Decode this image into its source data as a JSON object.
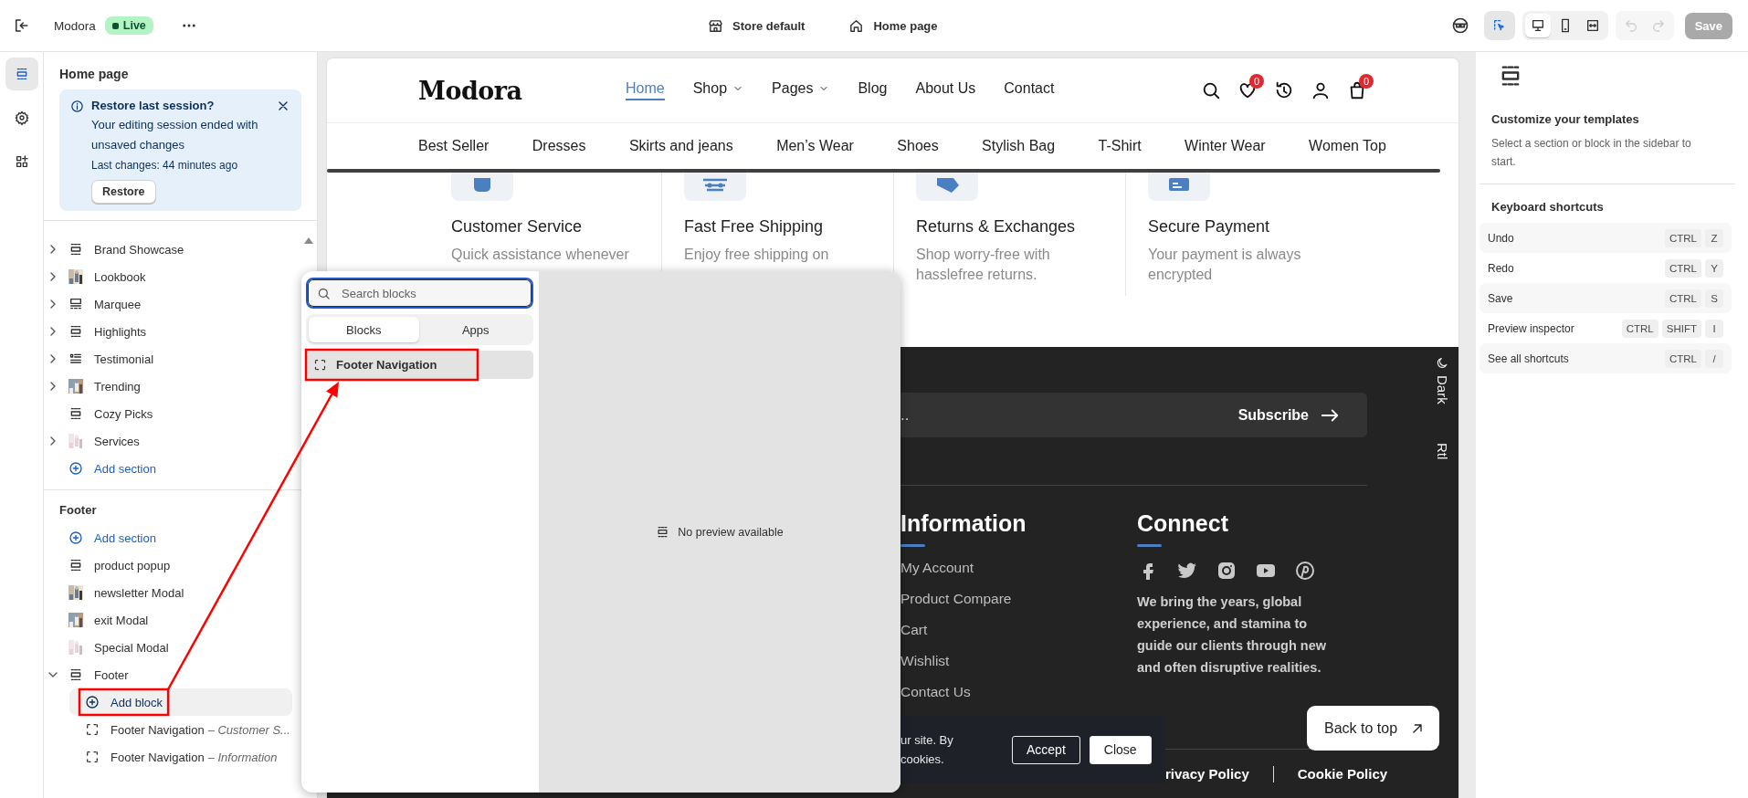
{
  "topbar": {
    "store_name": "Modora",
    "status": {
      "kind": "live",
      "label": "Live"
    },
    "context": [
      {
        "kind": "store",
        "label": "Store default"
      },
      {
        "kind": "page",
        "label": "Home page"
      }
    ],
    "tools": [
      {
        "kind": "select",
        "selected": true
      }
    ],
    "devices": [
      {
        "kind": "desktop",
        "selected": true
      },
      {
        "kind": "mobile",
        "selected": false
      },
      {
        "kind": "fullwidth",
        "selected": false
      }
    ],
    "history": [
      {
        "kind": "undo",
        "disabled": true
      },
      {
        "kind": "redo",
        "disabled": true
      }
    ],
    "save": {
      "label": "Save",
      "disabled": true
    }
  },
  "rail": [
    {
      "kind": "sections",
      "selected": true
    },
    {
      "kind": "settings",
      "selected": false
    },
    {
      "kind": "apps",
      "selected": false
    }
  ],
  "sidebar": {
    "title": "Home page",
    "notice": {
      "title": "Restore last session?",
      "message": "Your editing session ended with unsaved changes",
      "detail": "Last changes: 44 minutes ago",
      "button": "Restore"
    },
    "groups": [
      {
        "items": [
          {
            "kind": "section",
            "label": "Brand Showcase",
            "expandable": true,
            "expanded": false
          },
          {
            "kind": "thumb",
            "label": "Lookbook",
            "expandable": true,
            "expanded": false
          },
          {
            "kind": "marquee",
            "label": "Marquee",
            "expandable": true,
            "expanded": false
          },
          {
            "kind": "section",
            "label": "Highlights",
            "expandable": true,
            "expanded": false
          },
          {
            "kind": "testimonial",
            "label": "Testimonial",
            "expandable": true,
            "expanded": false
          },
          {
            "kind": "thumb",
            "label": "Trending",
            "expandable": true,
            "expanded": false
          },
          {
            "kind": "section",
            "label": "Cozy Picks",
            "expandable": false
          },
          {
            "kind": "thumb",
            "label": "Services",
            "expandable": true,
            "expanded": false
          },
          {
            "kind": "add",
            "label": "Add section"
          }
        ]
      },
      {
        "title": "Footer",
        "items": [
          {
            "kind": "add",
            "label": "Add section"
          },
          {
            "kind": "section",
            "label": "product popup",
            "expandable": false
          },
          {
            "kind": "thumb",
            "label": "newsletter Modal",
            "expandable": false
          },
          {
            "kind": "thumb",
            "label": "exit Modal",
            "expandable": false
          },
          {
            "kind": "thumb",
            "label": "Special Modal",
            "expandable": false
          },
          {
            "kind": "section",
            "label": "Footer",
            "expandable": true,
            "expanded": true,
            "children": [
              {
                "kind": "add",
                "label": "Add block",
                "hovered": true,
                "annotated": true
              },
              {
                "kind": "block",
                "label": "Footer Navigation",
                "detail": "– *Customer S...*"
              },
              {
                "kind": "block",
                "label": "Footer Navigation",
                "detail": "– *Information*"
              }
            ]
          }
        ]
      }
    ]
  },
  "popup": {
    "search": {
      "placeholder": "Search blocks"
    },
    "tabs": [
      {
        "label": "Blocks",
        "selected": true
      },
      {
        "label": "Apps",
        "selected": false
      }
    ],
    "blocks": [
      {
        "label": "Footer Navigation",
        "hovered": true,
        "annotated": true
      }
    ],
    "preview_message": "No preview available"
  },
  "annotations": {
    "arrow": true
  },
  "preview": {
    "logo": "Modora",
    "nav": [
      {
        "label": "Home",
        "selected": true,
        "dropdown": false
      },
      {
        "label": "Shop",
        "selected": false,
        "dropdown": true
      },
      {
        "label": "Pages",
        "selected": false,
        "dropdown": true
      },
      {
        "label": "Blog",
        "selected": false,
        "dropdown": false
      },
      {
        "label": "About Us",
        "selected": false,
        "dropdown": false
      },
      {
        "label": "Contact",
        "selected": false,
        "dropdown": false
      }
    ],
    "header_icons": [
      {
        "kind": "search"
      },
      {
        "kind": "wishlist",
        "badge": "0"
      },
      {
        "kind": "history"
      },
      {
        "kind": "account"
      },
      {
        "kind": "cart",
        "badge": "0"
      }
    ],
    "categories": [
      "Best Seller",
      "Dresses",
      "Skirts and jeans",
      "Men’s Wear",
      "Shoes",
      "Stylish Bag",
      "T-Shirt",
      "Winter Wear",
      "Women Top"
    ],
    "features": [
      {
        "title": "Customer Service",
        "text": "Quick assistance whenever"
      },
      {
        "title": "Fast Free Shipping",
        "text": "Enjoy free shipping on"
      },
      {
        "title": "Returns & Exchanges",
        "text": "Shop worry-free with hasslefree returns."
      },
      {
        "title": "Secure Payment",
        "text": "Your payment is always encrypted"
      }
    ],
    "footer": {
      "newsletter": {
        "placeholder": "..",
        "button": "Subscribe"
      },
      "information": {
        "title": "Information",
        "links": [
          "My Account",
          "Product Compare",
          "Cart",
          "Wishlist",
          "Contact Us"
        ]
      },
      "connect": {
        "title": "Connect",
        "social": [
          {
            "kind": "facebook"
          },
          {
            "kind": "twitter"
          },
          {
            "kind": "instagram"
          },
          {
            "kind": "youtube"
          },
          {
            "kind": "pinterest"
          }
        ],
        "text": "We bring the years, global experience, and stamina to guide our clients through new and often disruptive realities."
      },
      "legal": [
        "rivacy Policy",
        "Cookie Policy"
      ],
      "cookie_banner": {
        "lines": [
          "ur site. By",
          "cookies."
        ],
        "buttons": [
          {
            "kind": "outline",
            "label": "Accept"
          },
          {
            "kind": "solid",
            "label": "Close"
          }
        ]
      },
      "back_to_top": "Back to top",
      "side_toggles": [
        {
          "kind": "theme",
          "label": "Dark"
        },
        {
          "kind": "direction",
          "label": "Rtl"
        }
      ]
    }
  },
  "inspector": {
    "title": "Customize your templates",
    "text": "Select a section or block in the sidebar to start.",
    "shortcuts_title": "Keyboard shortcuts",
    "shortcuts": [
      {
        "label": "Undo",
        "keys": [
          "CTRL",
          "Z"
        ]
      },
      {
        "label": "Redo",
        "keys": [
          "CTRL",
          "Y"
        ]
      },
      {
        "label": "Save",
        "keys": [
          "CTRL",
          "S"
        ]
      },
      {
        "label": "Preview inspector",
        "keys": [
          "CTRL",
          "SHIFT",
          "I"
        ]
      },
      {
        "label": "See all shortcuts",
        "keys": [
          "CTRL",
          "/"
        ]
      }
    ]
  }
}
